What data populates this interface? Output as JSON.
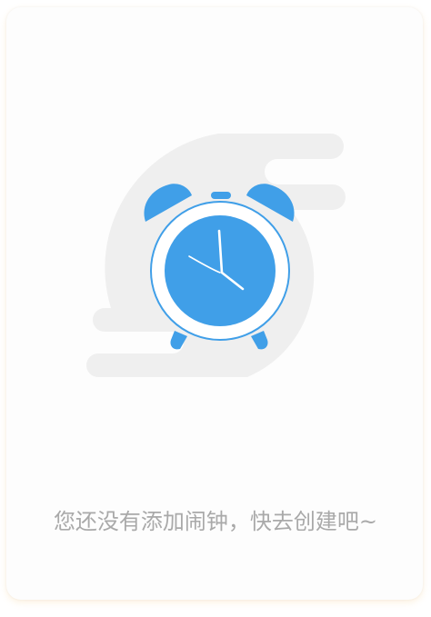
{
  "empty_state": {
    "message": "您还没有添加闹钟，快去创建吧~",
    "illustration_icon": "alarm-clock-icon"
  },
  "colors": {
    "clock_blue": "#409fe8",
    "clock_border": "#ffffff",
    "background_blob": "#efefef",
    "text": "#a9a9a9",
    "card_shadow": "#f6c478"
  }
}
